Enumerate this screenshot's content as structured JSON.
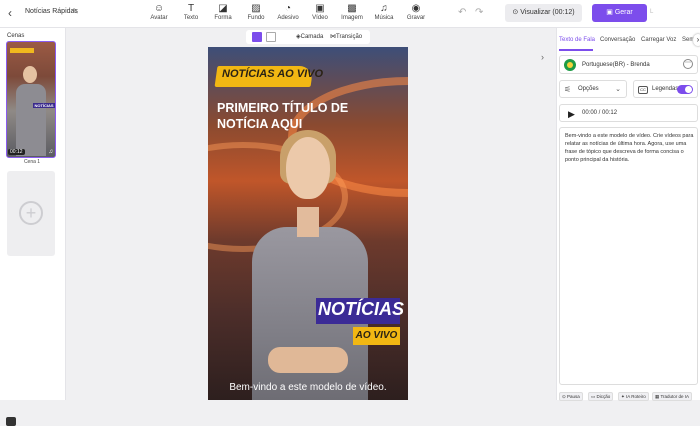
{
  "header": {
    "back_icon": "back-chevron-icon",
    "project_title": "Notícias Rápidas",
    "tools": [
      {
        "label": "Avatar",
        "icon": "avatar-icon"
      },
      {
        "label": "Texto",
        "icon": "text-icon"
      },
      {
        "label": "Forma",
        "icon": "shape-icon"
      },
      {
        "label": "Fundo",
        "icon": "background-icon"
      },
      {
        "label": "Adesivo",
        "icon": "sticker-icon"
      },
      {
        "label": "Vídeo",
        "icon": "video-icon"
      },
      {
        "label": "Imagem",
        "icon": "image-icon"
      },
      {
        "label": "Música",
        "icon": "music-icon"
      },
      {
        "label": "Gravar",
        "icon": "record-icon"
      }
    ],
    "visualize_label": "Visualizar (00:12)",
    "generate_label": "Gerar",
    "cut_label": "L"
  },
  "scenes": {
    "title": "Cenas",
    "items": [
      {
        "label": "Cena 1",
        "duration": "00:12",
        "thumb_badge": "NOTÍCIAS"
      }
    ],
    "add_icon": "plus-icon"
  },
  "canvas_toolbar": {
    "layer_label": "Camada",
    "transition_label": "Transição"
  },
  "video": {
    "banner": "NOTÍCIAS AO VIVO",
    "headline": "PRIMEIRO TÍTULO DE NOTÍCIA AQUI",
    "badge_top": "NOTÍCIAS",
    "badge_bottom": "AO VIVO",
    "caption": "Bem-vindo a este modelo de vídeo."
  },
  "right_panel": {
    "tabs": [
      {
        "label": "Texto de Fala",
        "active": true
      },
      {
        "label": "Conversação",
        "active": false
      },
      {
        "label": "Carregar Voz",
        "active": false
      },
      {
        "label": "Sem",
        "active": false
      }
    ],
    "voice": "Portuguese(BR) - Brenda",
    "options_label": "Opções",
    "captions_label": "Legendas",
    "captions_on": true,
    "time_display": "00:00 / 00:12",
    "script_text": "Bem-vindo a este modelo de vídeo. Crie vídeos para relatar as notícias de última hora. Agora, use uma frase de tópico que descreva de forma concisa o ponto principal da história.",
    "bottom_buttons": [
      "Pausa",
      "Dicção",
      "IA Roteiro",
      "Tradutor de IA"
    ]
  },
  "colors": {
    "accent": "#7c4dec",
    "banner_yellow": "#f2b713",
    "badge_purple": "#3b2b96"
  }
}
